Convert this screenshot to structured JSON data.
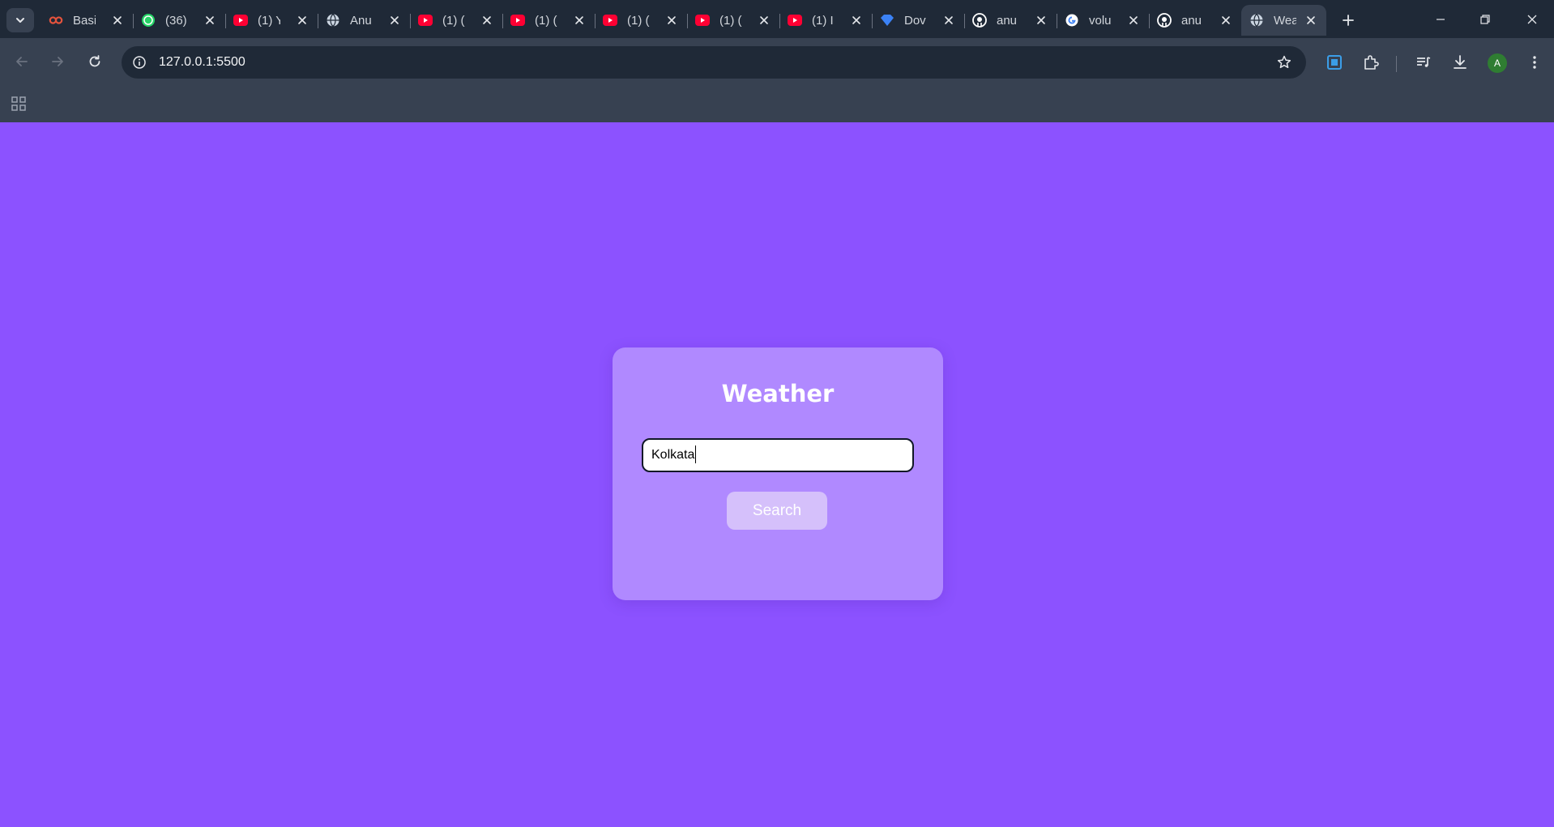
{
  "browser": {
    "tabs": [
      {
        "title": "Basi",
        "icon": "infinity-icon",
        "color": "#e5533d"
      },
      {
        "title": "(36)",
        "icon": "whatsapp-icon",
        "color": "#25d366"
      },
      {
        "title": "(1) Y",
        "icon": "youtube-icon",
        "color": "#ff0033"
      },
      {
        "title": "Anu",
        "icon": "globe-icon",
        "color": "#cbd5e1"
      },
      {
        "title": "(1) (",
        "icon": "youtube-icon",
        "color": "#ff0033"
      },
      {
        "title": "(1) (",
        "icon": "youtube-icon",
        "color": "#ff0033"
      },
      {
        "title": "(1) (",
        "icon": "youtube-icon",
        "color": "#ff0033"
      },
      {
        "title": "(1) (",
        "icon": "youtube-icon",
        "color": "#ff0033"
      },
      {
        "title": "(1) I",
        "icon": "youtube-icon",
        "color": "#ff0033"
      },
      {
        "title": "Dov",
        "icon": "diamond-icon",
        "color": "#3b82f6"
      },
      {
        "title": "anu",
        "icon": "github-icon",
        "color": "#ffffff"
      },
      {
        "title": "volu",
        "icon": "google-icon",
        "color": "#4285f4"
      },
      {
        "title": "anu",
        "icon": "github-icon",
        "color": "#ffffff"
      },
      {
        "title": "Wea",
        "icon": "globe-icon",
        "color": "#cbd5e1",
        "active": true
      }
    ],
    "url": "127.0.0.1:5500",
    "profile_initial": "A"
  },
  "app": {
    "title": "Weather",
    "city_input_value": "Kolkata",
    "search_label": "Search"
  },
  "colors": {
    "page_background": "#8c52ff",
    "card_background": "#b089ff",
    "button_background": "#d5c0fb"
  }
}
